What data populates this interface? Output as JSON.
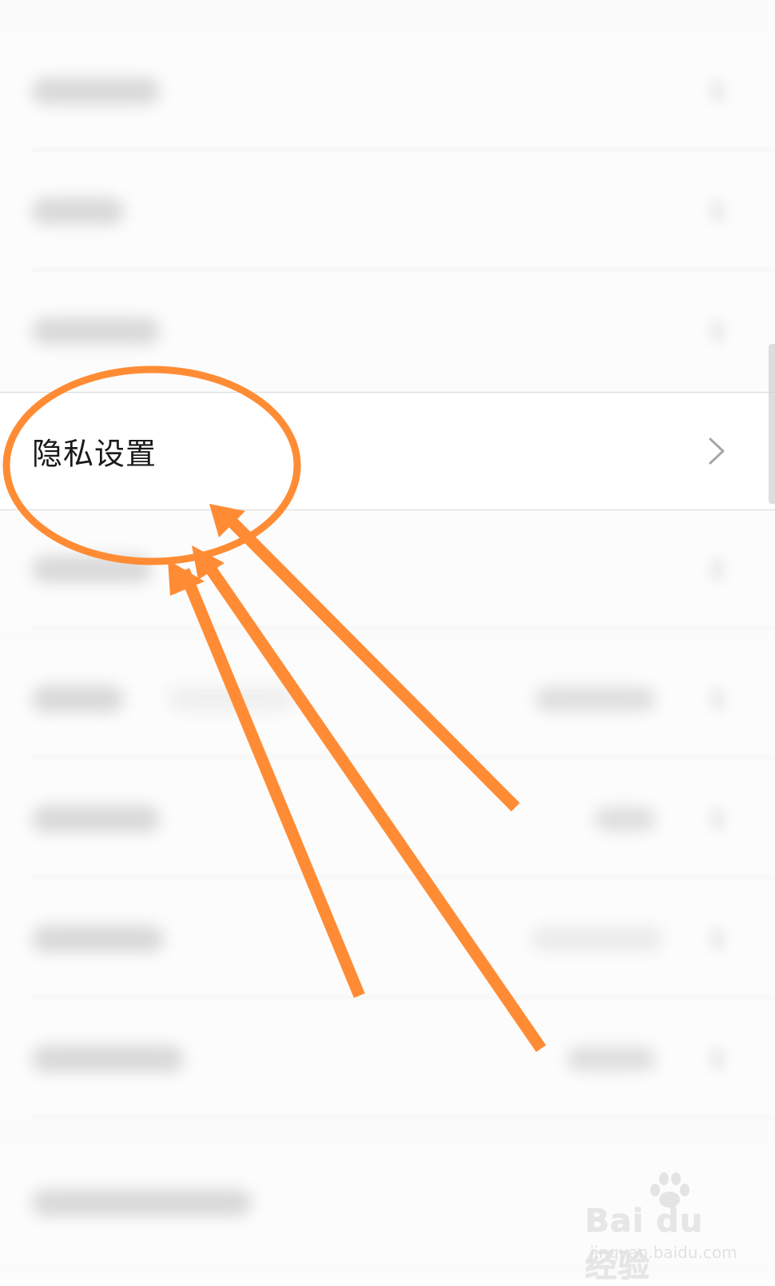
{
  "settings": {
    "privacy_label": "隐私设置"
  },
  "icons": {
    "row_chevron": "chevron-right-icon",
    "watermark_logo": "baidu-paw-icon"
  },
  "colors": {
    "annotation_orange": "#FF8C35",
    "separator": "#D9D9D9",
    "chevron": "#A6A6A6"
  },
  "watermark": {
    "brand": "Bai du 经验",
    "url": "jingyan.baidu.com"
  }
}
